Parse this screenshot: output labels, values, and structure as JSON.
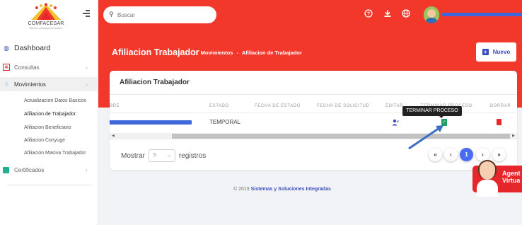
{
  "brand": {
    "name": "COMFACESAR",
    "tagline": "Nuevos construyendo sueños"
  },
  "sidebar": {
    "items": [
      {
        "label": "Dashboard"
      },
      {
        "label": "Consultas"
      },
      {
        "label": "Movimientos"
      },
      {
        "label": "Certificados"
      }
    ],
    "submenu": [
      {
        "label": "Actualizacion Datos Basicos"
      },
      {
        "label": "Afiliacion de Trabajador"
      },
      {
        "label": "Afiliacion Beneficiario"
      },
      {
        "label": "Afiliacion Conyuge"
      },
      {
        "label": "Afiliacion Masiva Trabajador"
      }
    ]
  },
  "topbar": {
    "search_placeholder": "Buscar"
  },
  "header": {
    "title": "Afiliacion Trabajador",
    "breadcrumb": [
      "Movimientos",
      "-",
      "Afiliacion de Trabajador"
    ],
    "new_button": "Nuevo"
  },
  "card": {
    "title": "Afiliacion Trabajador",
    "columns": [
      "BRE",
      "ESTADO",
      "FECHA DE ESTADO",
      "FECHA DE SOLICITUD",
      "EDITAR",
      "TERMINAR PROCESO",
      "BORRAR"
    ],
    "rows": [
      {
        "estado": "TEMPORAL"
      }
    ],
    "tooltip": "TERMINAR PROCESO",
    "show_prefix": "Mostrar",
    "page_size": "5",
    "show_suffix": "registros",
    "pagination": [
      "«",
      "‹",
      "1",
      "›",
      "»"
    ],
    "current_page": "1"
  },
  "footer": {
    "text": "© 2019",
    "brand": "Sistemas y Soluciones Integradas"
  },
  "agent": {
    "line1": "Agent",
    "line2": "Virtua"
  },
  "colors": {
    "primary_red": "#f2372b",
    "accent_blue": "#3a4dbd",
    "page_blue": "#4a6cf5"
  }
}
